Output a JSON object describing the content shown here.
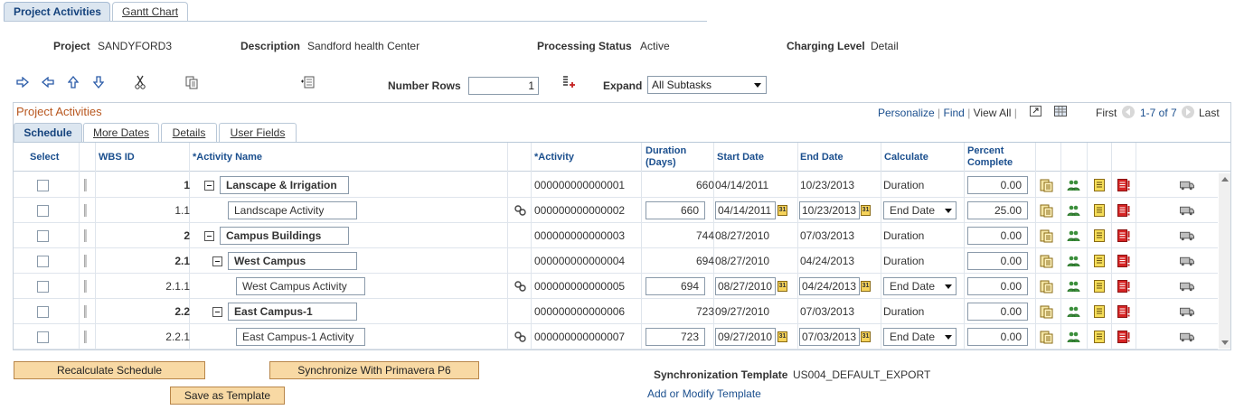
{
  "page_tabs": [
    "Project Activities",
    "Gantt Chart"
  ],
  "header": {
    "project_label": "Project",
    "project_value": "SANDYFORD3",
    "description_label": "Description",
    "description_value": "Sandford health Center",
    "status_label": "Processing Status",
    "status_value": "Active",
    "charging_label": "Charging Level",
    "charging_value": "Detail"
  },
  "toolbar": {
    "icons": [
      "indent-right-icon",
      "outdent-left-icon",
      "move-up-icon",
      "move-down-icon",
      "cut-icon",
      "copy-icon",
      "insert-row-icon",
      "add-rows-icon"
    ],
    "number_rows_label": "Number Rows",
    "number_rows_value": "1",
    "expand_label": "Expand",
    "expand_value": "All Subtasks"
  },
  "grid": {
    "title": "Project Activities",
    "nav": {
      "personalize": "Personalize",
      "find": "Find",
      "view_all": "View All",
      "first": "First",
      "range": "1-7 of 7",
      "last": "Last"
    },
    "tabs": [
      "Schedule",
      "More Dates",
      "Details",
      "User Fields"
    ],
    "columns": [
      "Select",
      "WBS ID",
      "*Activity Name",
      "*Activity",
      "Duration (Days)",
      "Start Date",
      "End Date",
      "Calculate",
      "Percent Complete"
    ],
    "rows": [
      {
        "wbs": "1",
        "name": "Lanscape & Irrigation",
        "activity": "000000000000001",
        "duration": "660",
        "start": "04/14/2011",
        "end": "10/23/2013",
        "calculate": "Duration",
        "percent": "0.00"
      },
      {
        "wbs": "1.1",
        "name": "Landscape Activity",
        "activity": "000000000000002",
        "duration": "660",
        "start": "04/14/2011",
        "end": "10/23/2013",
        "calculate": "End Date",
        "percent": "25.00"
      },
      {
        "wbs": "2",
        "name": "Campus Buildings",
        "activity": "000000000000003",
        "duration": "744",
        "start": "08/27/2010",
        "end": "07/03/2013",
        "calculate": "Duration",
        "percent": "0.00"
      },
      {
        "wbs": "2.1",
        "name": "West Campus",
        "activity": "000000000000004",
        "duration": "694",
        "start": "08/27/2010",
        "end": "04/24/2013",
        "calculate": "Duration",
        "percent": "0.00"
      },
      {
        "wbs": "2.1.1",
        "name": "West Campus Activity",
        "activity": "000000000000005",
        "duration": "694",
        "start": "08/27/2010",
        "end": "04/24/2013",
        "calculate": "End Date",
        "percent": "0.00"
      },
      {
        "wbs": "2.2",
        "name": "East Campus-1",
        "activity": "000000000000006",
        "duration": "723",
        "start": "09/27/2010",
        "end": "07/03/2013",
        "calculate": "Duration",
        "percent": "0.00"
      },
      {
        "wbs": "2.2.1",
        "name": "East Campus-1 Activity",
        "activity": "000000000000007",
        "duration": "723",
        "start": "09/27/2010",
        "end": "07/03/2013",
        "calculate": "End Date",
        "percent": "0.00"
      }
    ]
  },
  "buttons": {
    "recalculate": "Recalculate Schedule",
    "synchronize": "Synchronize With Primavera P6",
    "save_template": "Save as Template"
  },
  "sync": {
    "label": "Synchronization Template",
    "value": "US004_DEFAULT_EXPORT",
    "link": "Add or Modify Template"
  }
}
